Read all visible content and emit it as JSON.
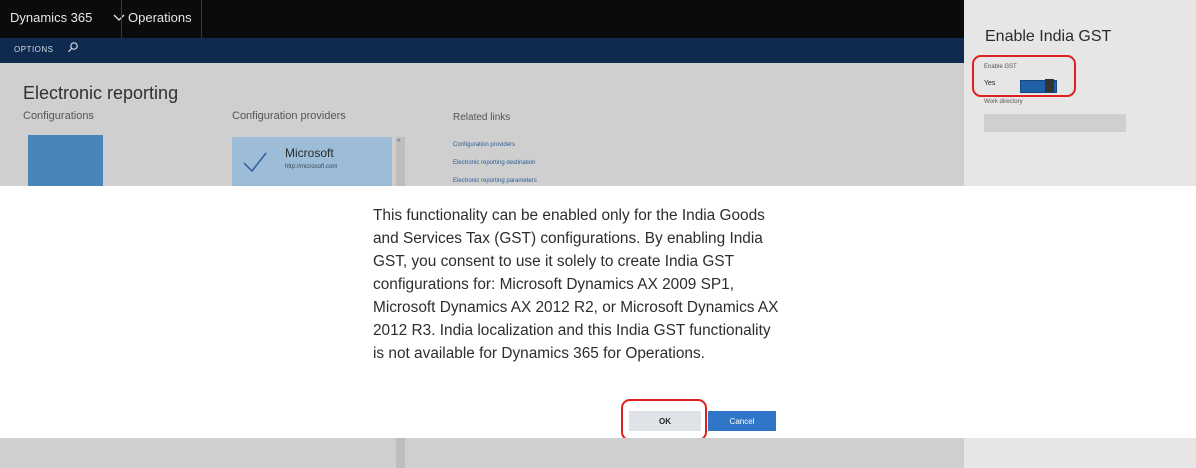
{
  "topbar": {
    "brand": "Dynamics 365",
    "module": "Operations"
  },
  "actionbar": {
    "options_label": "OPTIONS"
  },
  "workspace": {
    "page_title": "Electronic reporting",
    "configurations_header": "Configurations",
    "providers_header": "Configuration providers",
    "provider": {
      "name": "Microsoft",
      "url": "http://microsoft.com"
    },
    "related_links_header": "Related links",
    "related_links": [
      "Configuration providers",
      "Electronic reporting destination",
      "Electronic reporting parameters"
    ]
  },
  "panel": {
    "title": "Enable India GST",
    "enable_gst_label": "Enable GST",
    "enable_gst_value": "Yes",
    "enable_gst_on": true,
    "work_directory_label": "Work directory",
    "work_directory_value": ""
  },
  "dialog": {
    "message": "This functionality can be enabled only for the India Goods and Services Tax (GST) configurations. By enabling India GST, you consent to use it solely to create India GST configurations for: Microsoft Dynamics AX 2009 SP1, Microsoft Dynamics AX 2012 R2, or Microsoft Dynamics AX 2012 R3. India localization and this India GST functionality is not available for Dynamics 365 for Operations.",
    "ok_label": "OK",
    "cancel_label": "Cancel"
  },
  "colors": {
    "topbar": "#0b0b0b",
    "actionbar": "#0e2a4e",
    "accent": "#2f76c9",
    "highlight": "#e02020"
  },
  "icons": {
    "check": "checkmark-icon",
    "search": "search-icon",
    "chevron": "chevron-down-icon"
  }
}
